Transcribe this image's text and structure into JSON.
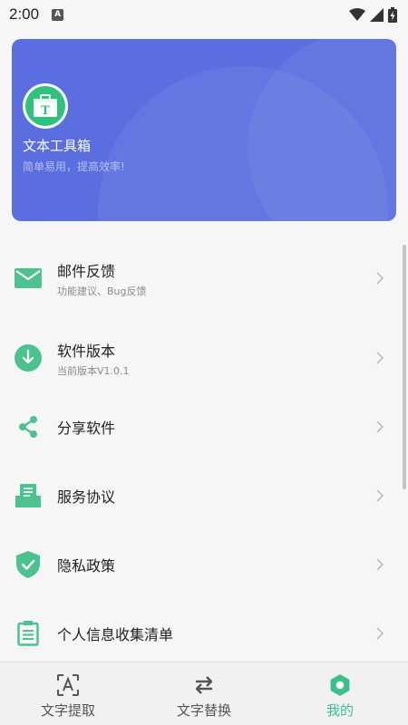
{
  "status_bar": {
    "time": "2:00",
    "indicator": "A"
  },
  "header": {
    "app_name": "文本工具箱",
    "slogan": "简单易用，提高效率!",
    "logo_letter": "T",
    "bg_color": "#5a6ee0",
    "logo_color": "#2ec27e"
  },
  "menu": {
    "items": [
      {
        "title": "邮件反馈",
        "subtitle": "功能建议、Bug反馈",
        "icon": "mail-icon"
      },
      {
        "title": "软件版本",
        "subtitle": "当前版本V1.0.1",
        "icon": "download-icon"
      },
      {
        "title": "分享软件",
        "subtitle": "",
        "icon": "share-icon"
      },
      {
        "title": "服务协议",
        "subtitle": "",
        "icon": "agreement-icon"
      },
      {
        "title": "隐私政策",
        "subtitle": "",
        "icon": "shield-check-icon"
      },
      {
        "title": "个人信息收集清单",
        "subtitle": "",
        "icon": "clipboard-icon"
      }
    ]
  },
  "bottom_nav": {
    "tabs": [
      {
        "label": "文字提取",
        "icon": "text-scan-icon",
        "active": false
      },
      {
        "label": "文字替换",
        "icon": "swap-icon",
        "active": false
      },
      {
        "label": "我的",
        "icon": "profile-icon",
        "active": true
      }
    ],
    "accent": "#3cc08a"
  },
  "icon_color": "#4cc38f"
}
